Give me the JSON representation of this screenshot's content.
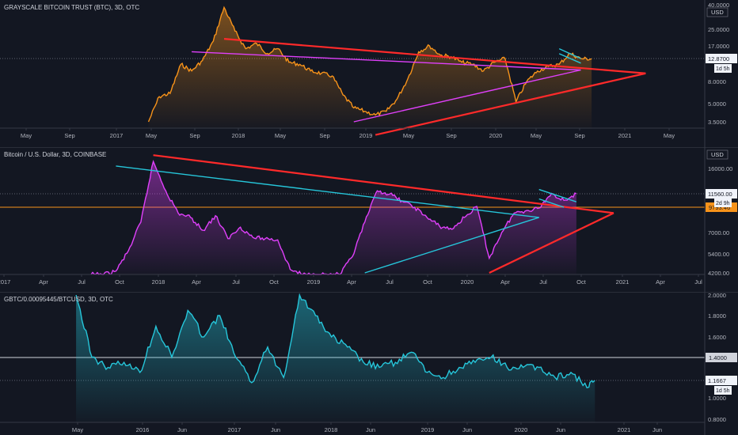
{
  "colors": {
    "background": "#131722",
    "text": "#d1d4dc",
    "axis_line": "#363a45"
  },
  "panes": [
    {
      "title": "GRAYSCALE BITCOIN TRUST (BTC), 3D, OTC",
      "price_labels": [
        "40.0000",
        "25.0000",
        "17.0000",
        "8.0000",
        "5.0000",
        "3.5000"
      ],
      "currency": "USD",
      "last_price": "12.8700",
      "countdown": "1d 5h",
      "time_labels": [
        "May",
        "Sep",
        "2017",
        "May",
        "Sep",
        "2018",
        "May",
        "Sep",
        "2019",
        "May",
        "Sep",
        "2020",
        "May",
        "Sep",
        "2021",
        "May"
      ],
      "series_color": "#f7931a"
    },
    {
      "title": "Bitcoin / U.S. Dollar, 3D, COINBASE",
      "price_labels": [
        "16000.00",
        "7000.00",
        "5400.00",
        "4200.00"
      ],
      "currency": "USD",
      "last_price": "11560.00",
      "countdown": "2d 9h",
      "level_price": "9793.46",
      "time_labels": [
        "2017",
        "Apr",
        "Jul",
        "Oct",
        "2018",
        "Apr",
        "Jul",
        "Oct",
        "2019",
        "Apr",
        "Jul",
        "Oct",
        "2020",
        "Apr",
        "Jul",
        "Oct",
        "2021",
        "Apr",
        "Jul"
      ],
      "series_color": "#e040fb"
    },
    {
      "title": "GBTC/0.00095445/BTCUSD, 3D, OTC",
      "price_labels": [
        "2.0000",
        "1.8000",
        "1.6000",
        "1.0000",
        "0.8000"
      ],
      "level_price": "1.4000",
      "last_price": "1.1667",
      "countdown": "1d 5h",
      "time_labels": [
        "May",
        "2016",
        "Jun",
        "2017",
        "Jun",
        "2018",
        "Jun",
        "2019",
        "Jun",
        "2020",
        "Jun",
        "2021",
        "Jun"
      ],
      "series_color": "#26c6da"
    }
  ],
  "chart_data": [
    {
      "type": "area",
      "title": "GRAYSCALE BITCOIN TRUST (BTC), 3D, OTC",
      "scale": "log",
      "ylim": [
        3.3,
        40
      ],
      "x": [
        "2017-05",
        "2017-06",
        "2017-07",
        "2017-08",
        "2017-09",
        "2017-10",
        "2017-11",
        "2017-12",
        "2018-01",
        "2018-02",
        "2018-03",
        "2018-04",
        "2018-05",
        "2018-06",
        "2018-07",
        "2018-08",
        "2018-09",
        "2018-10",
        "2018-11",
        "2018-12",
        "2019-01",
        "2019-02",
        "2019-03",
        "2019-04",
        "2019-05",
        "2019-06",
        "2019-07",
        "2019-08",
        "2019-09",
        "2019-10",
        "2019-11",
        "2019-12",
        "2020-01",
        "2020-02",
        "2020-03",
        "2020-04",
        "2020-05",
        "2020-06",
        "2020-07",
        "2020-08",
        "2020-09",
        "2020-10"
      ],
      "series": [
        {
          "values": [
            3.5,
            5.8,
            6.2,
            11.5,
            10,
            12.5,
            19,
            38,
            24,
            16,
            18,
            14.5,
            16,
            12,
            11.5,
            10,
            9.5,
            9,
            6,
            4.6,
            4.3,
            4.0,
            4.3,
            5.5,
            8.5,
            15,
            17,
            14,
            13.5,
            12,
            11.5,
            10,
            12,
            13,
            5.2,
            8,
            10,
            11,
            11.5,
            14.5,
            13,
            12.87
          ]
        }
      ],
      "trendlines": [
        {
          "color": "#ff2a2a",
          "points": [
            [
              "2017-12",
              20
            ],
            [
              "2021-03",
              9.5
            ]
          ]
        },
        {
          "color": "#ff2a2a",
          "points": [
            [
              "2019-02",
              3.3
            ],
            [
              "2021-03",
              9.5
            ]
          ]
        },
        {
          "color": "#e040fb",
          "points": [
            [
              "2017-09",
              15
            ],
            [
              "2020-09",
              10.2
            ]
          ]
        },
        {
          "color": "#e040fb",
          "points": [
            [
              "2018-12",
              3.5
            ],
            [
              "2020-09",
              10.2
            ]
          ]
        },
        {
          "color": "#26c6da",
          "points": [
            [
              "2020-07",
              16
            ],
            [
              "2020-09",
              13
            ]
          ]
        },
        {
          "color": "#26c6da",
          "points": [
            [
              "2020-07",
              14.4
            ],
            [
              "2020-09",
              11.8
            ]
          ]
        }
      ]
    },
    {
      "type": "area",
      "title": "Bitcoin / U.S. Dollar, 3D, COINBASE",
      "scale": "log",
      "ylim": [
        4200,
        20000
      ],
      "x": [
        "2017-07",
        "2017-08",
        "2017-09",
        "2017-10",
        "2017-11",
        "2017-12",
        "2018-01",
        "2018-02",
        "2018-03",
        "2018-04",
        "2018-05",
        "2018-06",
        "2018-07",
        "2018-08",
        "2018-09",
        "2018-10",
        "2018-11",
        "2018-12",
        "2019-01",
        "2019-02",
        "2019-03",
        "2019-04",
        "2019-05",
        "2019-06",
        "2019-07",
        "2019-08",
        "2019-09",
        "2019-10",
        "2019-11",
        "2019-12",
        "2020-01",
        "2020-02",
        "2020-03",
        "2020-04",
        "2020-05",
        "2020-06",
        "2020-07",
        "2020-08",
        "2020-09",
        "2020-10"
      ],
      "series": [
        {
          "values": [
            2500,
            3800,
            4300,
            5600,
            8000,
            17500,
            12000,
            9000,
            8500,
            7200,
            8700,
            6500,
            7500,
            6600,
            6500,
            6400,
            4400,
            3600,
            3600,
            3700,
            4000,
            5200,
            8000,
            12000,
            11500,
            10500,
            9700,
            8500,
            7600,
            7300,
            8500,
            9800,
            5100,
            7000,
            9000,
            9300,
            9600,
            11600,
            10600,
            11560
          ]
        }
      ],
      "trendlines": [
        {
          "color": "#ff2a2a",
          "points": [
            [
              "2017-12",
              19000
            ],
            [
              "2021-01",
              9000
            ]
          ]
        },
        {
          "color": "#ff2a2a",
          "points": [
            [
              "2020-03",
              4200
            ],
            [
              "2021-01",
              9000
            ]
          ]
        },
        {
          "color": "#26c6da",
          "points": [
            [
              "2017-09",
              16500
            ],
            [
              "2020-07",
              8500
            ]
          ]
        },
        {
          "color": "#26c6da",
          "points": [
            [
              "2019-05",
              4200
            ],
            [
              "2020-07",
              8500
            ]
          ]
        },
        {
          "color": "#26c6da",
          "points": [
            [
              "2020-07",
              12200
            ],
            [
              "2020-10",
              10400
            ]
          ]
        },
        {
          "color": "#26c6da",
          "points": [
            [
              "2020-07",
              10800
            ],
            [
              "2020-09",
              9700
            ]
          ]
        }
      ]
    },
    {
      "type": "line",
      "title": "GBTC/0.00095445/BTCUSD, 3D, OTC",
      "scale": "linear",
      "ylim": [
        0.75,
        2.05
      ],
      "x": [
        "2015-05",
        "2015-07",
        "2015-09",
        "2015-11",
        "2016-01",
        "2016-03",
        "2016-05",
        "2016-07",
        "2016-09",
        "2016-11",
        "2017-01",
        "2017-03",
        "2017-05",
        "2017-07",
        "2017-09",
        "2017-11",
        "2018-01",
        "2018-03",
        "2018-05",
        "2018-07",
        "2018-09",
        "2018-11",
        "2019-01",
        "2019-03",
        "2019-05",
        "2019-07",
        "2019-09",
        "2019-11",
        "2020-01",
        "2020-03",
        "2020-05",
        "2020-07",
        "2020-09",
        "2020-10"
      ],
      "series": [
        {
          "values": [
            2.0,
            1.4,
            1.3,
            1.35,
            1.25,
            1.7,
            1.4,
            1.85,
            1.6,
            1.8,
            1.4,
            1.15,
            1.5,
            1.2,
            2.0,
            1.8,
            1.6,
            1.5,
            1.35,
            1.3,
            1.35,
            1.45,
            1.25,
            1.2,
            1.3,
            1.35,
            1.4,
            1.3,
            1.3,
            1.3,
            1.2,
            1.25,
            1.1,
            1.17
          ]
        }
      ],
      "level_lines": [
        1.4
      ]
    }
  ]
}
